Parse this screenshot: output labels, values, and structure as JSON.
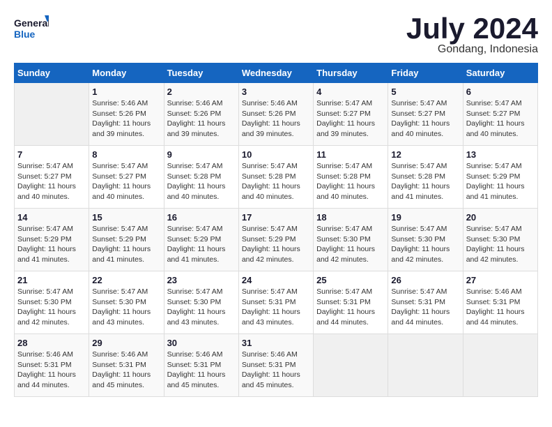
{
  "logo": {
    "line1": "General",
    "line2": "Blue"
  },
  "title": "July 2024",
  "location": "Gondang, Indonesia",
  "weekdays": [
    "Sunday",
    "Monday",
    "Tuesday",
    "Wednesday",
    "Thursday",
    "Friday",
    "Saturday"
  ],
  "weeks": [
    [
      {
        "day": "",
        "info": ""
      },
      {
        "day": "1",
        "info": "Sunrise: 5:46 AM\nSunset: 5:26 PM\nDaylight: 11 hours\nand 39 minutes."
      },
      {
        "day": "2",
        "info": "Sunrise: 5:46 AM\nSunset: 5:26 PM\nDaylight: 11 hours\nand 39 minutes."
      },
      {
        "day": "3",
        "info": "Sunrise: 5:46 AM\nSunset: 5:26 PM\nDaylight: 11 hours\nand 39 minutes."
      },
      {
        "day": "4",
        "info": "Sunrise: 5:47 AM\nSunset: 5:27 PM\nDaylight: 11 hours\nand 39 minutes."
      },
      {
        "day": "5",
        "info": "Sunrise: 5:47 AM\nSunset: 5:27 PM\nDaylight: 11 hours\nand 40 minutes."
      },
      {
        "day": "6",
        "info": "Sunrise: 5:47 AM\nSunset: 5:27 PM\nDaylight: 11 hours\nand 40 minutes."
      }
    ],
    [
      {
        "day": "7",
        "info": "Sunrise: 5:47 AM\nSunset: 5:27 PM\nDaylight: 11 hours\nand 40 minutes."
      },
      {
        "day": "8",
        "info": "Sunrise: 5:47 AM\nSunset: 5:27 PM\nDaylight: 11 hours\nand 40 minutes."
      },
      {
        "day": "9",
        "info": "Sunrise: 5:47 AM\nSunset: 5:28 PM\nDaylight: 11 hours\nand 40 minutes."
      },
      {
        "day": "10",
        "info": "Sunrise: 5:47 AM\nSunset: 5:28 PM\nDaylight: 11 hours\nand 40 minutes."
      },
      {
        "day": "11",
        "info": "Sunrise: 5:47 AM\nSunset: 5:28 PM\nDaylight: 11 hours\nand 40 minutes."
      },
      {
        "day": "12",
        "info": "Sunrise: 5:47 AM\nSunset: 5:28 PM\nDaylight: 11 hours\nand 41 minutes."
      },
      {
        "day": "13",
        "info": "Sunrise: 5:47 AM\nSunset: 5:29 PM\nDaylight: 11 hours\nand 41 minutes."
      }
    ],
    [
      {
        "day": "14",
        "info": "Sunrise: 5:47 AM\nSunset: 5:29 PM\nDaylight: 11 hours\nand 41 minutes."
      },
      {
        "day": "15",
        "info": "Sunrise: 5:47 AM\nSunset: 5:29 PM\nDaylight: 11 hours\nand 41 minutes."
      },
      {
        "day": "16",
        "info": "Sunrise: 5:47 AM\nSunset: 5:29 PM\nDaylight: 11 hours\nand 41 minutes."
      },
      {
        "day": "17",
        "info": "Sunrise: 5:47 AM\nSunset: 5:29 PM\nDaylight: 11 hours\nand 42 minutes."
      },
      {
        "day": "18",
        "info": "Sunrise: 5:47 AM\nSunset: 5:30 PM\nDaylight: 11 hours\nand 42 minutes."
      },
      {
        "day": "19",
        "info": "Sunrise: 5:47 AM\nSunset: 5:30 PM\nDaylight: 11 hours\nand 42 minutes."
      },
      {
        "day": "20",
        "info": "Sunrise: 5:47 AM\nSunset: 5:30 PM\nDaylight: 11 hours\nand 42 minutes."
      }
    ],
    [
      {
        "day": "21",
        "info": "Sunrise: 5:47 AM\nSunset: 5:30 PM\nDaylight: 11 hours\nand 42 minutes."
      },
      {
        "day": "22",
        "info": "Sunrise: 5:47 AM\nSunset: 5:30 PM\nDaylight: 11 hours\nand 43 minutes."
      },
      {
        "day": "23",
        "info": "Sunrise: 5:47 AM\nSunset: 5:30 PM\nDaylight: 11 hours\nand 43 minutes."
      },
      {
        "day": "24",
        "info": "Sunrise: 5:47 AM\nSunset: 5:31 PM\nDaylight: 11 hours\nand 43 minutes."
      },
      {
        "day": "25",
        "info": "Sunrise: 5:47 AM\nSunset: 5:31 PM\nDaylight: 11 hours\nand 44 minutes."
      },
      {
        "day": "26",
        "info": "Sunrise: 5:47 AM\nSunset: 5:31 PM\nDaylight: 11 hours\nand 44 minutes."
      },
      {
        "day": "27",
        "info": "Sunrise: 5:46 AM\nSunset: 5:31 PM\nDaylight: 11 hours\nand 44 minutes."
      }
    ],
    [
      {
        "day": "28",
        "info": "Sunrise: 5:46 AM\nSunset: 5:31 PM\nDaylight: 11 hours\nand 44 minutes."
      },
      {
        "day": "29",
        "info": "Sunrise: 5:46 AM\nSunset: 5:31 PM\nDaylight: 11 hours\nand 45 minutes."
      },
      {
        "day": "30",
        "info": "Sunrise: 5:46 AM\nSunset: 5:31 PM\nDaylight: 11 hours\nand 45 minutes."
      },
      {
        "day": "31",
        "info": "Sunrise: 5:46 AM\nSunset: 5:31 PM\nDaylight: 11 hours\nand 45 minutes."
      },
      {
        "day": "",
        "info": ""
      },
      {
        "day": "",
        "info": ""
      },
      {
        "day": "",
        "info": ""
      }
    ]
  ]
}
